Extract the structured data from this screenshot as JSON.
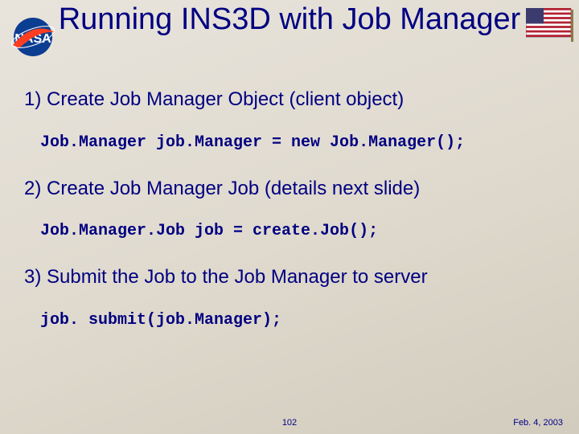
{
  "title": "Running INS3D with Job Manager",
  "points": {
    "p1": "1) Create Job Manager Object (client object)",
    "c1": "Job.Manager job.Manager = new Job.Manager();",
    "p2": "2) Create Job Manager Job (details next slide)",
    "c2": "Job.Manager.Job job = create.Job();",
    "p3": "3) Submit the Job to the Job Manager to server",
    "c3": "job. submit(job.Manager);"
  },
  "footer": {
    "page": "102",
    "date": "Feb. 4, 2003"
  },
  "logos": {
    "left": "nasa-logo",
    "right": "us-flag"
  }
}
